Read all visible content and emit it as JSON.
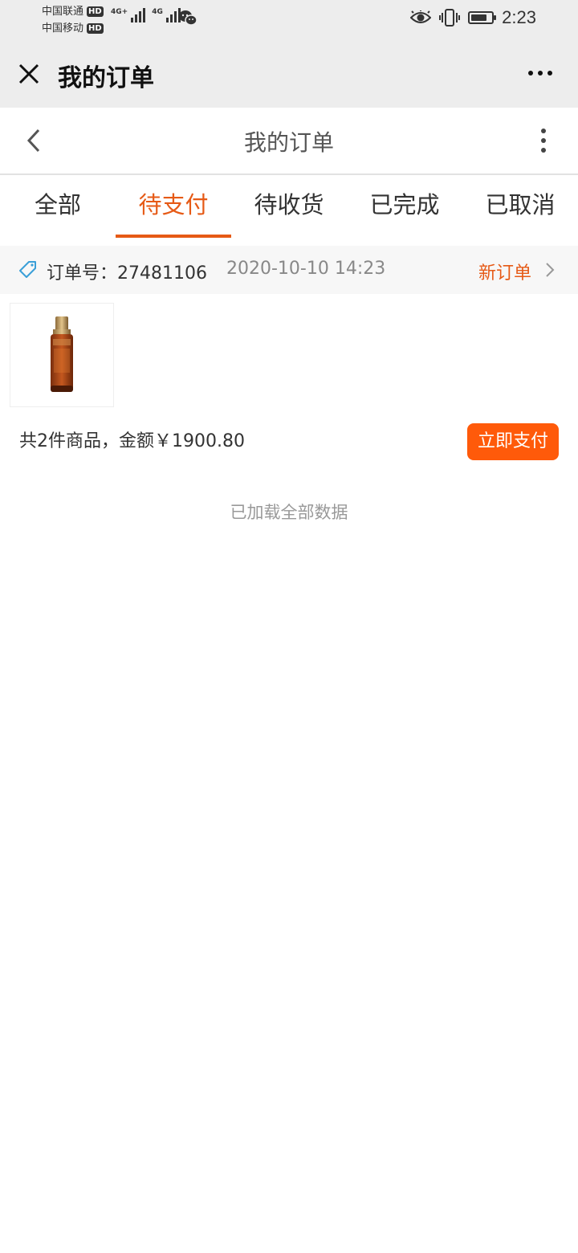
{
  "status_bar": {
    "carrier1": "中国联通",
    "carrier2": "中国移动",
    "hd_badge": "HD",
    "network1": "4G+",
    "network2": "4G",
    "time": "2:23",
    "battery_level": 0.8,
    "icons": [
      "eye-icon",
      "vibrate-icon",
      "battery-icon",
      "wechat-icon"
    ]
  },
  "wechat_bar": {
    "title": "我的订单",
    "close_icon": "close-icon",
    "more_icon": "more-icon"
  },
  "page_header": {
    "title": "我的订单",
    "back_icon": "chevron-left-icon",
    "menu_icon": "kebab-menu-icon"
  },
  "tabs": [
    {
      "label": "全部",
      "active": false
    },
    {
      "label": "待支付",
      "active": true
    },
    {
      "label": "待收货",
      "active": false
    },
    {
      "label": "已完成",
      "active": false
    },
    {
      "label": "已取消",
      "active": false
    }
  ],
  "accent_color": "#e65a16",
  "button_color": "#ff5a0a",
  "order": {
    "label": "订单号：",
    "number": "27481106",
    "date": "2020-10-10 14:23",
    "status": "新订单",
    "summary": "共2件商品，金额￥1900.80",
    "pay_button": "立即支付",
    "product_image": "serum-bottle"
  },
  "footer": {
    "loaded_text": "已加载全部数据"
  }
}
